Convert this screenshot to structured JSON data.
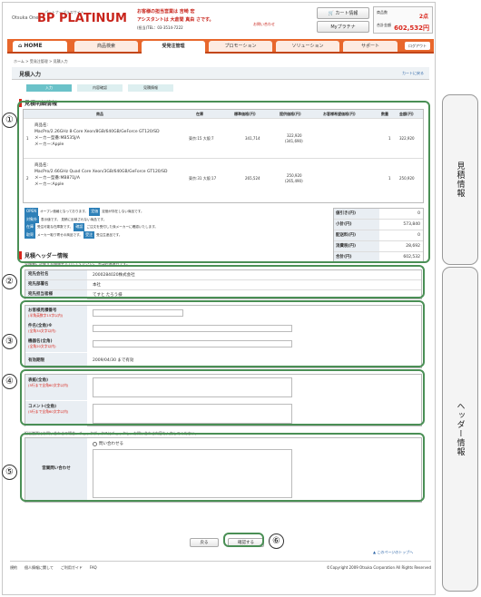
{
  "header": {
    "brand_small": "Otsuka One",
    "brand_big": "BP PLATINUM",
    "brand_sub": "パートナープラスサイト",
    "notice_line1": "お客様の担当営業は 吉崎 宏",
    "notice_line2": "アシスタントは 大倉間 真由 さです。",
    "phone": "(担当)TEL：03-3514-7222",
    "inquiry": "お問い合わせ",
    "cart_label": "カート情報",
    "myplat_label": "Myプラチナ",
    "item_count_label": "商品数",
    "item_count": "2点",
    "total_label": "合計金額",
    "total_value": "602,532円"
  },
  "nav": {
    "home": "HOME",
    "items": [
      "商品検索",
      "受発注管理",
      "プロモーション",
      "ソリューション",
      "サポート"
    ],
    "logout": "ログアウト"
  },
  "breadcrumb": "ホーム > 受発注管理 > 見積入力",
  "page_title": "見積入力",
  "back_to_cart": "カートに戻る",
  "steps": [
    "入力",
    "内容確認",
    "見積情報"
  ],
  "detail_section": {
    "title": "見積明細情報",
    "columns": [
      "商品",
      "在庫",
      "標準価格(円)",
      "提供価格(円)",
      "お客様希望価格(円)",
      "数量",
      "金額(円)"
    ],
    "rows": [
      {
        "no": "1",
        "product": "商品名:",
        "desc1": "MacPro/2.26GHz 8-Core Xeon/8GB/640GB/GeForce GT120/SD",
        "desc2": "メーカー型番:MB535J/A",
        "desc3": "メーカー:Apple",
        "stock": "東京:15 大阪:7",
        "std": "341,714",
        "offer": "322,920",
        "offer2": "(341,690)",
        "qty": "1",
        "amount": "322,920"
      },
      {
        "no": "2",
        "product": "商品名:",
        "desc1": "MacPro/2.66GHz Quad Core Xeon/3GB/640GB/GeForce GT120/SD",
        "desc2": "メーカー型番:MB871J/A",
        "desc3": "メーカー:Apple",
        "stock": "東京:31 大阪:17",
        "std": "265,524",
        "offer": "250,920",
        "offer2": "(265,490)",
        "qty": "1",
        "amount": "250,920"
      }
    ],
    "legend": [
      "オープン価格となっております。",
      "定価が存在しない商品です。",
      "表示値です。",
      "見積に反映されない商品です。",
      "受注可能な在庫数です。",
      "ご注文を受付した後メーカーに確認いたします。",
      "メーカー取り寄せの商品です。",
      "受注生産品です。"
    ],
    "totals": [
      {
        "label": "値引き(円)",
        "value": "0"
      },
      {
        "label": "小計(円)",
        "value": "573,840"
      },
      {
        "label": "配送料(円)",
        "value": "0"
      },
      {
        "label": "消費税(円)",
        "value": "28,692"
      },
      {
        "label": "合計(円)",
        "value": "602,532"
      }
    ]
  },
  "header_section": {
    "title": "見積ヘッダー情報",
    "note": "見積書に記載する情報を入力してください。 ※は必須項目です。",
    "company_label": "宛先会社名",
    "company_value": "2000284020株式会社",
    "dept_label": "宛先部署名",
    "dept_value": "本社",
    "person_label": "宛先担当者様",
    "person_value": "てすと たろう様",
    "po_label": "お客様見積番号",
    "po_sub": "(半角英数字15字以内)",
    "subject_label": "件名(全角)※",
    "subject_sub": "(全角34文字以内)",
    "model_label": "機器名(全角)",
    "model_sub": "(全角20文字以内)",
    "expiry_label": "有効期限",
    "expiry_value": "2009/04/30 まで有効",
    "subject2_label": "表紙(全角)",
    "subject2_sub": "(5行まで全角60文字以内)",
    "comment_label": "コメント(全角)",
    "comment_sub": "(5行まで全角60文字以内)",
    "inquiry_note": "担当営業にお問い合わせの場合、チェックボックスにチェックし、お問い合わせ内容を入力してください。",
    "inquiry_label": "営業問い合わせ",
    "inquiry_check": "問い合わせる"
  },
  "buttons": {
    "back": "戻る",
    "confirm": "確認する"
  },
  "page_top": "このページのトップへ",
  "footer": {
    "links": [
      "規約",
      "個人情報に関して",
      "ご利用ガイド",
      "FAQ"
    ],
    "copyright": "©Copyright 2009 Otsuka Corporation All Rights Reserved"
  },
  "side_tabs": [
    "見積情報",
    "ヘッダー情報"
  ],
  "callout_numbers": [
    "①",
    "②",
    "③",
    "④",
    "⑤",
    "⑥"
  ]
}
